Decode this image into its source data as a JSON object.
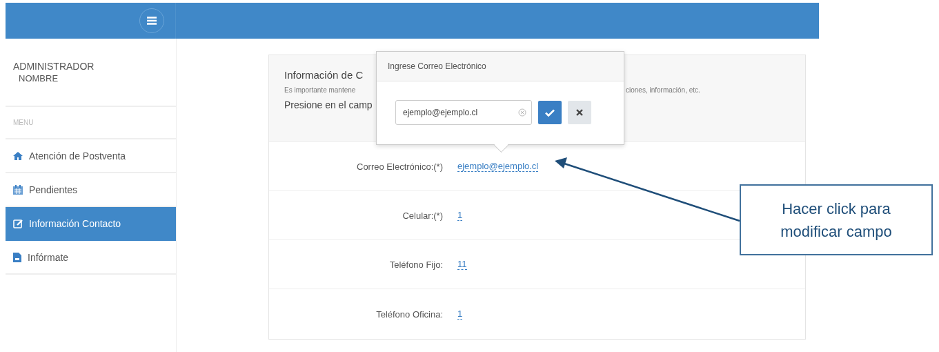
{
  "sidebar": {
    "user_role": "ADMINISTRADOR",
    "user_name": "NOMBRE",
    "menu_heading": "MENU",
    "items": [
      {
        "label": "Atención de Postventa",
        "selected": false
      },
      {
        "label": "Pendientes",
        "selected": false
      },
      {
        "label": "Información Contacto",
        "selected": true
      },
      {
        "label": "Infórmate",
        "selected": false
      }
    ]
  },
  "card": {
    "title": "Información de C",
    "description_left": "Es importante mantene",
    "description_right": "ciones, información, etc.",
    "instruction": "Presione en el camp",
    "fields": [
      {
        "label": "Correo Electrónico:(*)",
        "value": "ejemplo@ejemplo.cl"
      },
      {
        "label": "Celular:(*)",
        "value": "1"
      },
      {
        "label": "Teléfono Fijo:",
        "value": "11"
      },
      {
        "label": "Teléfono Oficina:",
        "value": "1"
      }
    ]
  },
  "popover": {
    "title": "Ingrese Correo Electrónico",
    "value": "ejemplo@ejemplo.cl"
  },
  "annotation": {
    "text": "Hacer click para modificar campo"
  }
}
